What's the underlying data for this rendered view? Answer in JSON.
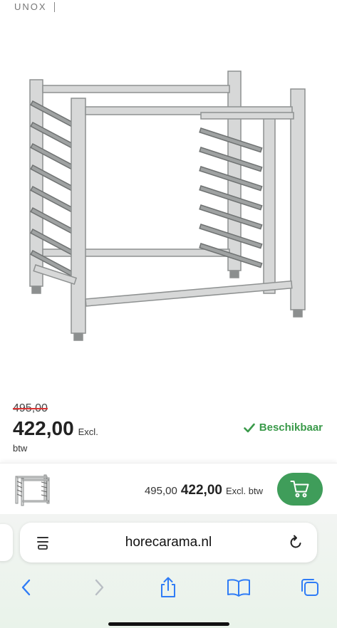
{
  "brand": {
    "name": "UNOX"
  },
  "product": {
    "image_alt": "oven rack stand",
    "old_price": "495,00",
    "price": "422,00",
    "excl_label": "Excl.",
    "btw_label": "btw",
    "availability": "Beschikbaar"
  },
  "sticky_bar": {
    "old_price": "495,00",
    "price": "422,00",
    "excl_label": "Excl. btw"
  },
  "browser": {
    "url": "horecarama.nl"
  },
  "colors": {
    "accent_green": "#3f9d5a",
    "availability_green": "#3a9a4a",
    "ios_blue": "#2f7cf6"
  },
  "icons": {
    "menu": "page-menu-icon",
    "reload": "reload-icon",
    "back": "chevron-left-icon",
    "forward": "chevron-right-icon",
    "share": "share-icon",
    "bookmarks": "book-icon",
    "tabs": "tabs-icon",
    "cart": "cart-icon",
    "check": "check-icon"
  }
}
